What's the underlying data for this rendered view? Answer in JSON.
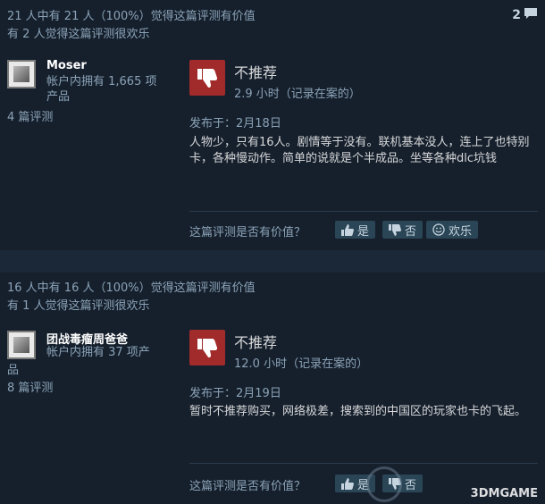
{
  "reviews": [
    {
      "helpful": "21 人中有 21 人（100%）觉得这篇评测有价值",
      "funny": "有 2 人觉得这篇评测很欢乐",
      "comments": "2",
      "author": "Moser",
      "owned_line1": "帐户内拥有 1,665 项",
      "owned_line2": "产品",
      "num_reviews": "4 篇评测",
      "recommendation": "不推荐",
      "hours": "2.9 小时（记录在案的）",
      "posted": "发布于：2月18日",
      "content": "人物少，只有16人。剧情等于没有。联机基本没人，连上了也特别卡，各种慢动作。简单的说就是个半成品。坐等各种dlc坑钱",
      "helpful_q": "这篇评测是否有价值？",
      "yes": "是",
      "no": "否",
      "funny_btn": "欢乐"
    },
    {
      "helpful": "16 人中有 16 人（100%）觉得这篇评测有价值",
      "funny": "有 1 人觉得这篇评测很欢乐",
      "author": "团战毒瘤周爸爸",
      "owned_line1": "帐户内拥有 37 项产",
      "owned_line2": "品",
      "num_reviews": "8 篇评测",
      "recommendation": "不推荐",
      "hours": "12.0 小时（记录在案的）",
      "posted": "发布于：2月19日",
      "content": "暂时不推荐购买，网络极差，搜索到的中国区的玩家也卡的飞起。",
      "helpful_q": "这篇评测是否有价值？",
      "yes": "是",
      "no": "否"
    }
  ],
  "watermark": "3DMGAME",
  "icons": [
    "thumbs-down-icon",
    "thumbs-up-icon",
    "smiley-icon",
    "comment-icon"
  ],
  "colors": {
    "background": "#1b2838",
    "review_bg": "#16202d",
    "not_recommended": "#a12a2a",
    "button": "#2a4556"
  }
}
